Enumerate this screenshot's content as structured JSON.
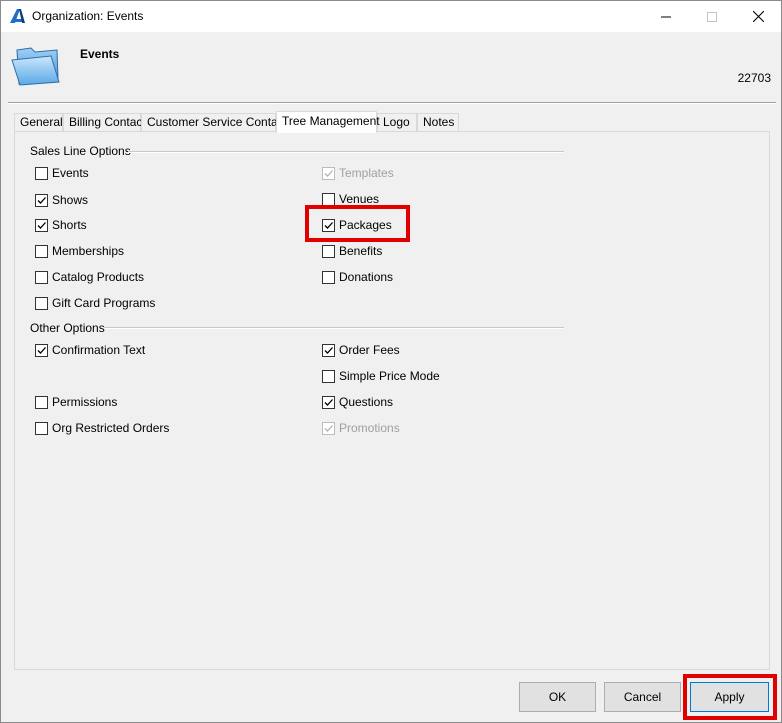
{
  "window": {
    "title": "Organization: Events"
  },
  "header": {
    "org_name": "Events",
    "org_id": "22703"
  },
  "tabs": [
    {
      "label": "General",
      "active": false
    },
    {
      "label": "Billing Contact",
      "active": false
    },
    {
      "label": "Customer Service Contact",
      "active": false
    },
    {
      "label": "Tree Management",
      "active": true
    },
    {
      "label": "Logo",
      "active": false
    },
    {
      "label": "Notes",
      "active": false
    }
  ],
  "sales_line_options": {
    "label": "Sales Line Options",
    "left": [
      {
        "label": "Events",
        "checked": false,
        "disabled": false
      },
      {
        "label": "Shows",
        "checked": true,
        "disabled": false
      },
      {
        "label": "Shorts",
        "checked": true,
        "disabled": false
      },
      {
        "label": "Memberships",
        "checked": false,
        "disabled": false
      },
      {
        "label": "Catalog Products",
        "checked": false,
        "disabled": false
      },
      {
        "label": "Gift Card Programs",
        "checked": false,
        "disabled": false
      }
    ],
    "right": [
      {
        "label": "Templates",
        "checked": true,
        "disabled": true
      },
      {
        "label": "Venues",
        "checked": false,
        "disabled": false
      },
      {
        "label": "Packages",
        "checked": true,
        "disabled": false
      },
      {
        "label": "Benefits",
        "checked": false,
        "disabled": false
      },
      {
        "label": "Donations",
        "checked": false,
        "disabled": false
      }
    ]
  },
  "other_options": {
    "label": "Other Options",
    "left": [
      {
        "label": "Confirmation Text",
        "checked": true,
        "disabled": false
      },
      {
        "label": "Permissions",
        "checked": false,
        "disabled": false
      },
      {
        "label": "Org Restricted Orders",
        "checked": false,
        "disabled": false
      }
    ],
    "right": [
      {
        "label": "Order Fees",
        "checked": true,
        "disabled": false
      },
      {
        "label": "Simple Price Mode",
        "checked": false,
        "disabled": false
      },
      {
        "label": "Questions",
        "checked": true,
        "disabled": false
      },
      {
        "label": "Promotions",
        "checked": true,
        "disabled": true
      }
    ]
  },
  "buttons": {
    "ok": "OK",
    "cancel": "Cancel",
    "apply": "Apply"
  },
  "colors": {
    "highlight": "#e00000",
    "accent": "#0078d7"
  }
}
